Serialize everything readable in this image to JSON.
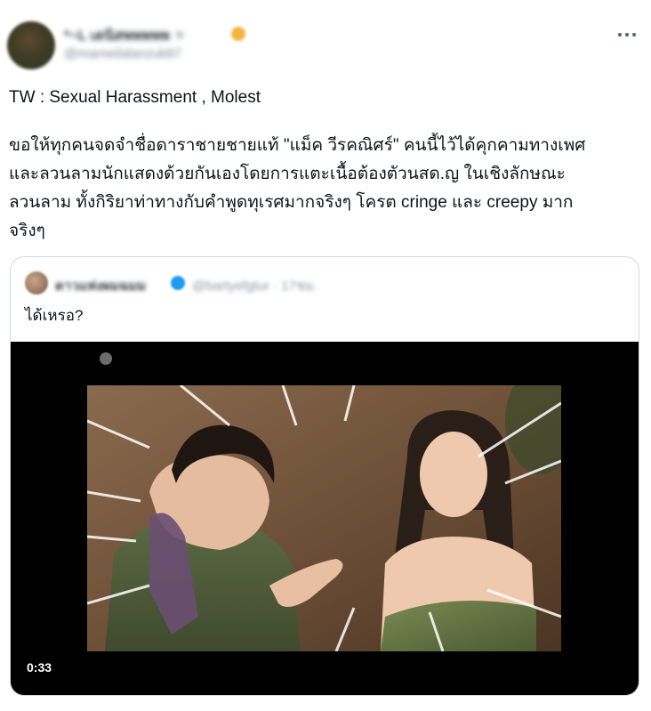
{
  "author": {
    "display_name": "*~L เดนิสพพพพพ ✧",
    "handle": "@mameilalanzuk87",
    "verified_badge_color": "#f3b43b",
    "more_icon": "more-horizontal-icon"
  },
  "tweet": {
    "trigger_warning": "TW : Sexual Harassment , Molest",
    "body_lines": [
      "ขอให้ทุกคนจดจำชื่อดาราชายชายแท้ \"แม็ค วีรคณิศร์\" คนนี้ไว้ได้คุกคามทางเพศ",
      "และลวนลามนักแสดงด้วยกันเองโดยการแตะเนื้อต้องตัวนสด.ญ ในเชิงลักษณะ",
      "ลวนลาม ทั้งกิริยาท่าทางกับคำพูดทุเรศมากจริงๆ โครต cringe และ creepy มาก",
      "จริงๆ"
    ]
  },
  "quote": {
    "name": "ดาวแห่งผมฉมม",
    "verified_color": "#1d9bf0",
    "meta": "@bartyefgtur · 17ชม.",
    "text": "ได้เหรอ?",
    "video": {
      "duration": "0:33"
    }
  },
  "colors": {
    "text": "#0f1419",
    "secondary": "#536471",
    "border": "#cfd9de",
    "accent": "#1d9bf0"
  }
}
